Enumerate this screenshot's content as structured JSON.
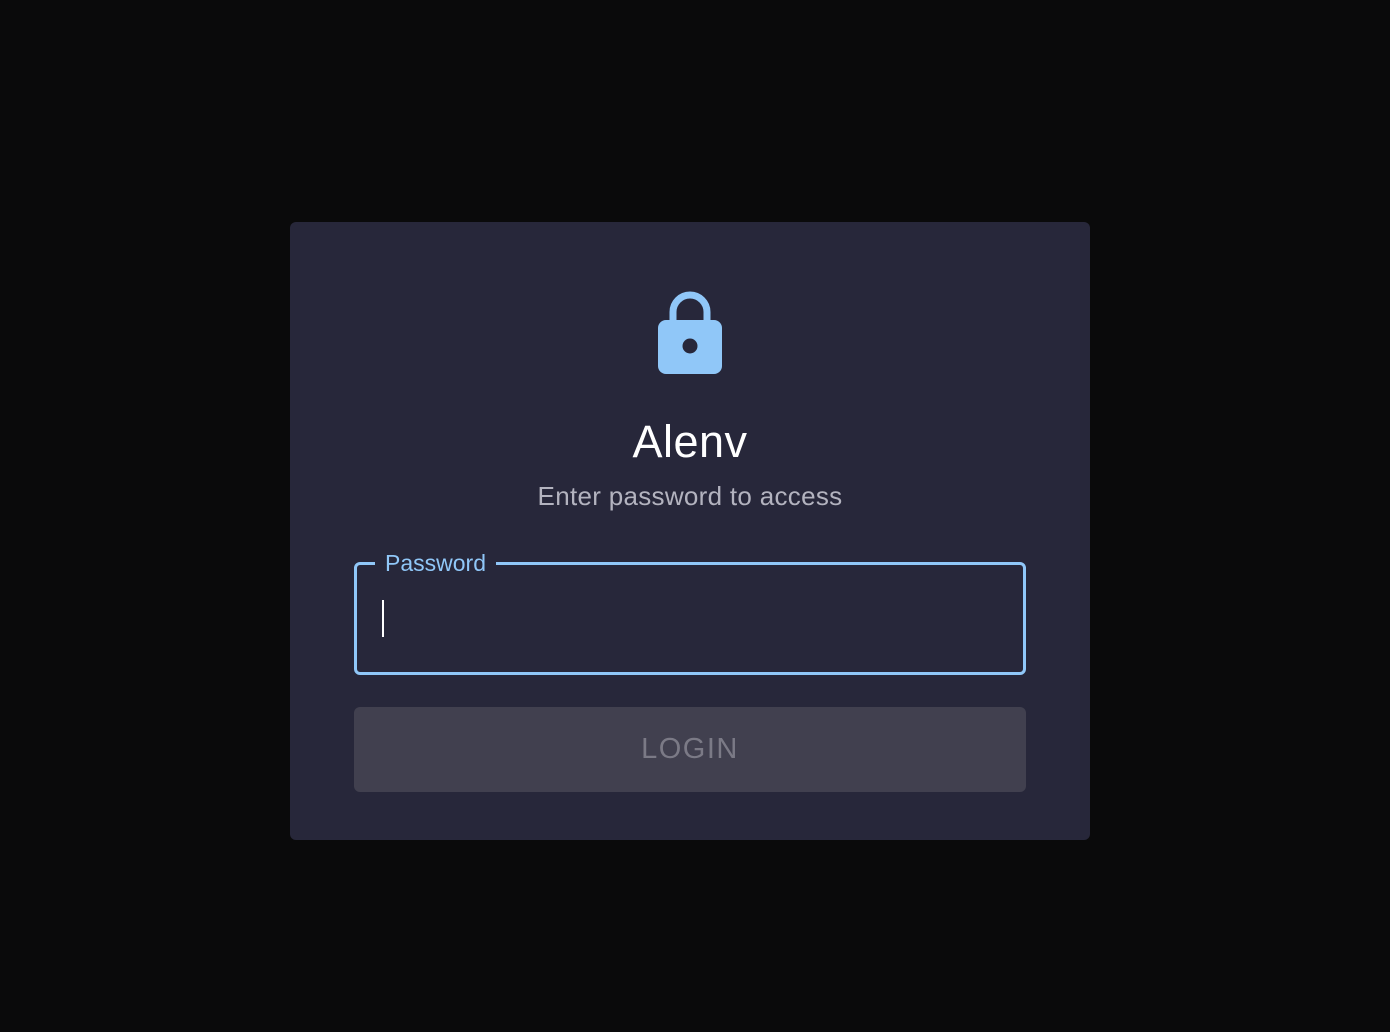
{
  "app": {
    "title": "Alenv",
    "subtitle": "Enter password to access"
  },
  "lock_icon": {
    "name": "lock-icon",
    "color": "#90c7f8"
  },
  "password_field": {
    "label": "Password",
    "value": "",
    "placeholder": ""
  },
  "login_button": {
    "label": "LOGIN",
    "disabled": true
  },
  "colors": {
    "background": "#0a0a0b",
    "card": "#27273a",
    "accent": "#90c7f8",
    "button_disabled_bg": "#41404f",
    "button_disabled_text": "#7b7a86"
  }
}
